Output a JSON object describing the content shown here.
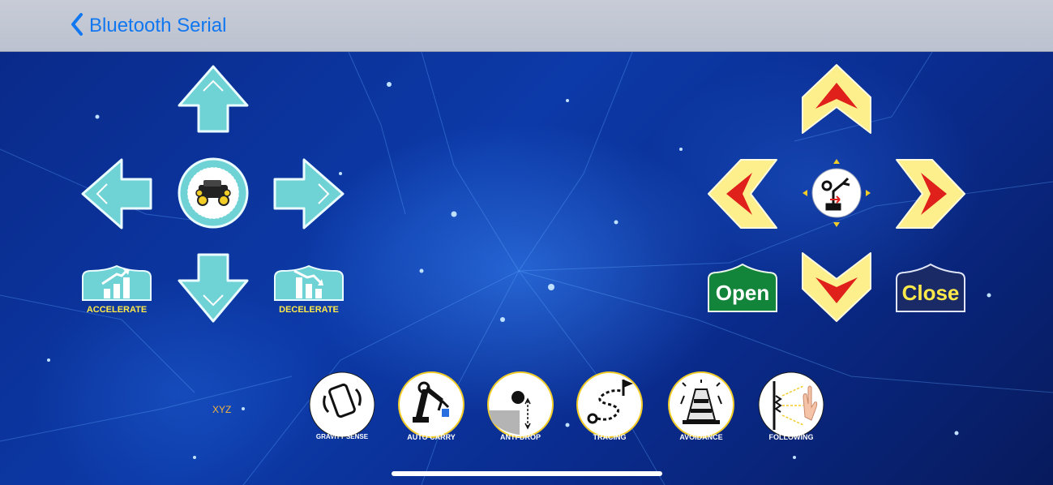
{
  "navbar": {
    "back_label": "Bluetooth Serial"
  },
  "drive": {
    "accelerate_label": "ACCELERATE",
    "decelerate_label": "DECELERATE"
  },
  "arm": {
    "open_label": "Open",
    "close_label": "Close"
  },
  "xyz_label": "XYZ",
  "modes": [
    {
      "label": "GRAVITY SENSE",
      "icon": "gravity-sense-icon"
    },
    {
      "label": "AUTO CARRY",
      "icon": "robot-arm-icon"
    },
    {
      "label": "ANTI-DROP",
      "icon": "anti-drop-icon"
    },
    {
      "label": "TRACING",
      "icon": "tracing-path-icon"
    },
    {
      "label": "AVOIDANCE",
      "icon": "traffic-cone-icon"
    },
    {
      "label": "FOLLOWING",
      "icon": "hand-follow-icon"
    }
  ],
  "colors": {
    "accent": "#1177f0",
    "drive_pad": "#6fd2d4",
    "arm_pad_fill": "#fdf08c",
    "arm_arrow": "#e0201b",
    "open_green": "#12853a",
    "close_navy": "#1a2a66",
    "label_yellow": "#fde94a"
  }
}
